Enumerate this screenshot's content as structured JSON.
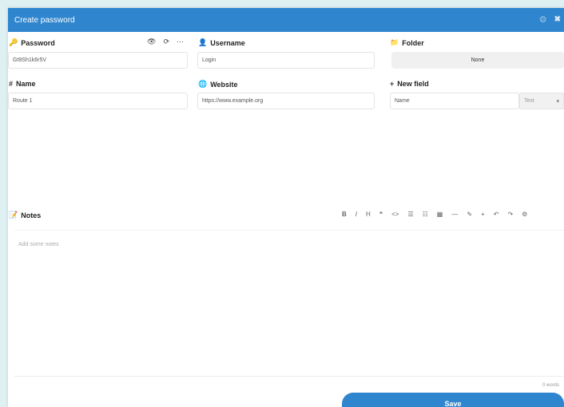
{
  "window": {
    "title": "Create password",
    "controls": {
      "settings": "⚙",
      "close": "✖"
    }
  },
  "colors": {
    "accent": "#2f86cf",
    "background": "#dff0f3"
  },
  "password": {
    "label": "Password",
    "icon": "key-icon",
    "value": "Gt9Sh1k6r5V",
    "actions": {
      "show": "👁",
      "regenerate": "⟳",
      "options": "⋯"
    }
  },
  "username": {
    "label": "Username",
    "icon": "user-icon",
    "value": "Login"
  },
  "folder": {
    "label": "Folder",
    "icon": "folder-icon",
    "button": "None"
  },
  "name": {
    "label": "Name",
    "icon": "hash-icon",
    "value": "Route 1"
  },
  "website": {
    "label": "Website",
    "icon": "globe-icon",
    "value": "https://www.example.org"
  },
  "new_field": {
    "label": "New field",
    "icon": "plus-icon",
    "value": "Name",
    "type": "Text"
  },
  "notes": {
    "label": "Notes",
    "icon": "note-icon",
    "placeholder": "Add some notes",
    "toolbar": [
      "B",
      "I",
      "H",
      "❝",
      "<>",
      "☰",
      "☷",
      "▦",
      "—",
      "✎",
      "+",
      "↶",
      "↷",
      "⚙"
    ],
    "word_count": "0 words"
  },
  "save": {
    "label": "Save"
  }
}
